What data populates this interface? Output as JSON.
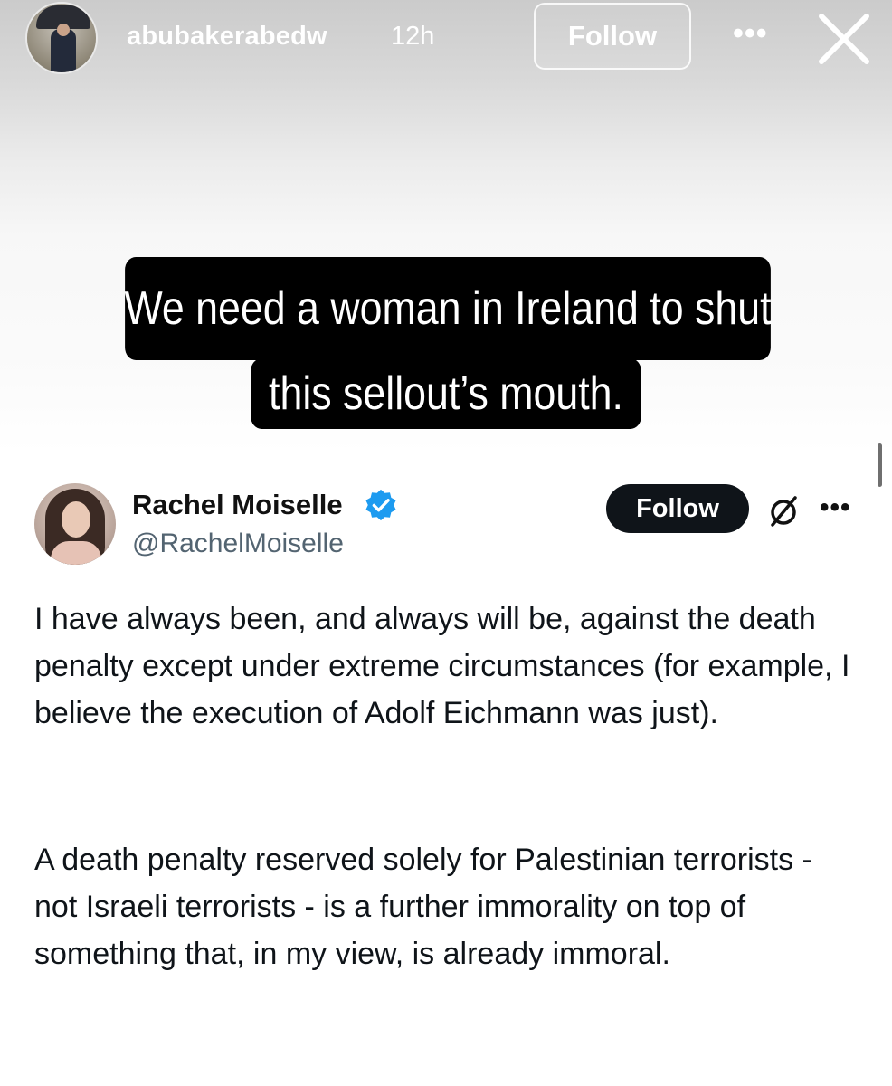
{
  "story": {
    "username": "abubakerabedw",
    "time": "12h",
    "follow_label": "Follow",
    "more_label": "•••",
    "close_icon": "close-icon",
    "caption_line1": "We need a woman in Ireland to shut",
    "caption_line2": "this sellout’s mouth."
  },
  "tweet": {
    "name": "Rachel Moiselle",
    "handle": "@RachelMoiselle",
    "follow_label": "Follow",
    "more_label": "•••",
    "verified_icon": "verified-badge-icon",
    "grok_icon": "grok-icon",
    "paragraph1": "I have always been, and always will be, against the death penalty except under extreme circumstances (for example, I believe the execution of Adolf Eichmann was just).",
    "paragraph2": "A death penalty reserved solely for Palestinian terrorists - not Israeli terrorists - is a further immorality on top of something that, in my view, is already immoral."
  },
  "colors": {
    "caption_bg": "#000000",
    "follow_bg": "#0f1419",
    "verified": "#1d9bf0",
    "handle": "#536471"
  }
}
